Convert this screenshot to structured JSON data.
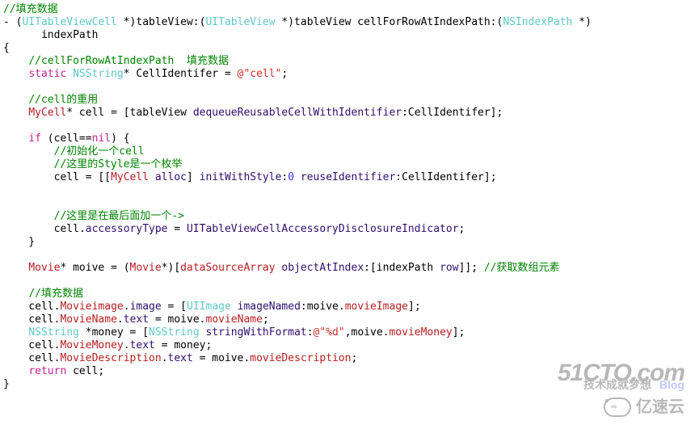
{
  "watermarks": {
    "cto": {
      "main": "51CTO.com",
      "sub1": "技术成就梦想",
      "sub2": "Blog"
    },
    "yisu": {
      "text": "亿速云",
      "icon_label": "∞"
    }
  },
  "code": {
    "tokens": [
      [
        {
          "c": "cm",
          "t": "//填充数据"
        }
      ],
      [
        {
          "c": "tx",
          "t": "- ("
        },
        {
          "c": "ty",
          "t": "UITableViewCell"
        },
        {
          "c": "tx",
          "t": " *)tableView:("
        },
        {
          "c": "ty",
          "t": "UITableView"
        },
        {
          "c": "tx",
          "t": " *)tableView cellForRowAtIndexPath:("
        },
        {
          "c": "ty",
          "t": "NSIndexPath"
        },
        {
          "c": "tx",
          "t": " *)"
        }
      ],
      [
        {
          "c": "tx",
          "t": "      indexPath"
        }
      ],
      [
        {
          "c": "tx",
          "t": "{"
        }
      ],
      [
        {
          "c": "tx",
          "t": "    "
        },
        {
          "c": "cm",
          "t": "//cellForRowAtIndexPath  填充数据"
        }
      ],
      [
        {
          "c": "tx",
          "t": "    "
        },
        {
          "c": "kw",
          "t": "static"
        },
        {
          "c": "tx",
          "t": " "
        },
        {
          "c": "ty",
          "t": "NSString"
        },
        {
          "c": "tx",
          "t": "* CellIdentifer = "
        },
        {
          "c": "st",
          "t": "@\"cell\""
        },
        {
          "c": "tx",
          "t": ";"
        }
      ],
      [
        {
          "c": "tx",
          "t": ""
        }
      ],
      [
        {
          "c": "tx",
          "t": "    "
        },
        {
          "c": "cm",
          "t": "//cell的重用"
        }
      ],
      [
        {
          "c": "tx",
          "t": "    "
        },
        {
          "c": "ut",
          "t": "MyCell"
        },
        {
          "c": "tx",
          "t": "* cell = [tableView "
        },
        {
          "c": "mt",
          "t": "dequeueReusableCellWithIdentifier"
        },
        {
          "c": "tx",
          "t": ":CellIdentifer];"
        }
      ],
      [
        {
          "c": "tx",
          "t": ""
        }
      ],
      [
        {
          "c": "tx",
          "t": "    "
        },
        {
          "c": "kw",
          "t": "if"
        },
        {
          "c": "tx",
          "t": " (cell=="
        },
        {
          "c": "kw",
          "t": "nil"
        },
        {
          "c": "tx",
          "t": ") {"
        }
      ],
      [
        {
          "c": "tx",
          "t": "        "
        },
        {
          "c": "cm",
          "t": "//初始化一个cell"
        }
      ],
      [
        {
          "c": "tx",
          "t": "        "
        },
        {
          "c": "cm",
          "t": "//这里的Style是一个枚举"
        }
      ],
      [
        {
          "c": "tx",
          "t": "        cell = [["
        },
        {
          "c": "ut",
          "t": "MyCell"
        },
        {
          "c": "tx",
          "t": " "
        },
        {
          "c": "mt",
          "t": "alloc"
        },
        {
          "c": "tx",
          "t": "] "
        },
        {
          "c": "mt",
          "t": "initWithStyle"
        },
        {
          "c": "tx",
          "t": ":"
        },
        {
          "c": "nu",
          "t": "0"
        },
        {
          "c": "tx",
          "t": " "
        },
        {
          "c": "mt",
          "t": "reuseIdentifier"
        },
        {
          "c": "tx",
          "t": ":CellIdentifer];"
        }
      ],
      [
        {
          "c": "tx",
          "t": ""
        }
      ],
      [
        {
          "c": "tx",
          "t": ""
        }
      ],
      [
        {
          "c": "tx",
          "t": "        "
        },
        {
          "c": "cm",
          "t": "//这里是在最后面加一个->"
        }
      ],
      [
        {
          "c": "tx",
          "t": "        cell."
        },
        {
          "c": "mt",
          "t": "accessoryType"
        },
        {
          "c": "tx",
          "t": " = "
        },
        {
          "c": "mt",
          "t": "UITableViewCellAccessoryDisclosureIndicator"
        },
        {
          "c": "tx",
          "t": ";"
        }
      ],
      [
        {
          "c": "tx",
          "t": "    }"
        }
      ],
      [
        {
          "c": "tx",
          "t": ""
        }
      ],
      [
        {
          "c": "tx",
          "t": "    "
        },
        {
          "c": "ut",
          "t": "Movie"
        },
        {
          "c": "tx",
          "t": "* moive = ("
        },
        {
          "c": "ut",
          "t": "Movie"
        },
        {
          "c": "tx",
          "t": "*)["
        },
        {
          "c": "ut",
          "t": "dataSourceArray"
        },
        {
          "c": "tx",
          "t": " "
        },
        {
          "c": "mt",
          "t": "objectAtIndex"
        },
        {
          "c": "tx",
          "t": ":[indexPath "
        },
        {
          "c": "mt",
          "t": "row"
        },
        {
          "c": "tx",
          "t": "]]; "
        },
        {
          "c": "cm",
          "t": "//获取数组元素"
        }
      ],
      [
        {
          "c": "tx",
          "t": ""
        }
      ],
      [
        {
          "c": "tx",
          "t": "    "
        },
        {
          "c": "cm",
          "t": "//填充数据"
        }
      ],
      [
        {
          "c": "tx",
          "t": "    cell."
        },
        {
          "c": "ut",
          "t": "Movieimage"
        },
        {
          "c": "tx",
          "t": "."
        },
        {
          "c": "mt",
          "t": "image"
        },
        {
          "c": "tx",
          "t": " = ["
        },
        {
          "c": "ty",
          "t": "UIImage"
        },
        {
          "c": "tx",
          "t": " "
        },
        {
          "c": "mt",
          "t": "imageNamed"
        },
        {
          "c": "tx",
          "t": ":moive."
        },
        {
          "c": "ut",
          "t": "movieImage"
        },
        {
          "c": "tx",
          "t": "];"
        }
      ],
      [
        {
          "c": "tx",
          "t": "    cell."
        },
        {
          "c": "ut",
          "t": "MovieName"
        },
        {
          "c": "tx",
          "t": "."
        },
        {
          "c": "mt",
          "t": "text"
        },
        {
          "c": "tx",
          "t": " = moive."
        },
        {
          "c": "ut",
          "t": "movieName"
        },
        {
          "c": "tx",
          "t": ";"
        }
      ],
      [
        {
          "c": "tx",
          "t": "    "
        },
        {
          "c": "ty",
          "t": "NSString"
        },
        {
          "c": "tx",
          "t": " *money = ["
        },
        {
          "c": "ty",
          "t": "NSString"
        },
        {
          "c": "tx",
          "t": " "
        },
        {
          "c": "mt",
          "t": "stringWithFormat"
        },
        {
          "c": "tx",
          "t": ":"
        },
        {
          "c": "st",
          "t": "@\"%d\""
        },
        {
          "c": "tx",
          "t": ",moive."
        },
        {
          "c": "ut",
          "t": "movieMoney"
        },
        {
          "c": "tx",
          "t": "];"
        }
      ],
      [
        {
          "c": "tx",
          "t": "    cell."
        },
        {
          "c": "ut",
          "t": "MovieMoney"
        },
        {
          "c": "tx",
          "t": "."
        },
        {
          "c": "mt",
          "t": "text"
        },
        {
          "c": "tx",
          "t": " = money;"
        }
      ],
      [
        {
          "c": "tx",
          "t": "    cell."
        },
        {
          "c": "ut",
          "t": "MovieDescription"
        },
        {
          "c": "tx",
          "t": "."
        },
        {
          "c": "mt",
          "t": "text"
        },
        {
          "c": "tx",
          "t": " = moive."
        },
        {
          "c": "ut",
          "t": "movieDescription"
        },
        {
          "c": "tx",
          "t": ";"
        }
      ],
      [
        {
          "c": "tx",
          "t": "    "
        },
        {
          "c": "kw",
          "t": "return"
        },
        {
          "c": "tx",
          "t": " cell;"
        }
      ],
      [
        {
          "c": "tx",
          "t": "}"
        }
      ]
    ]
  }
}
